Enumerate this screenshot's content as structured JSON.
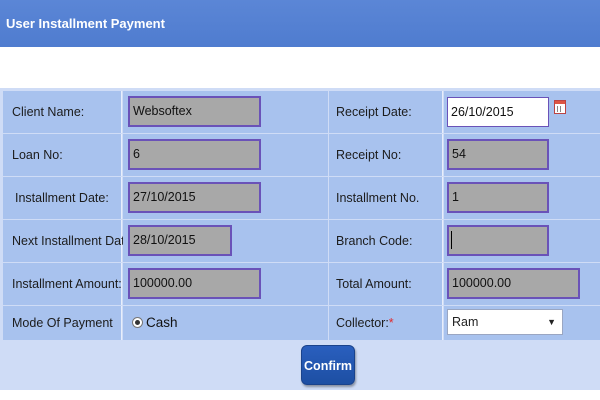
{
  "header": {
    "title": "User Installment Payment"
  },
  "form": {
    "client_name": {
      "label": "Client Name:",
      "value": "Websoftex"
    },
    "loan_no": {
      "label": "Loan No:",
      "value": "6"
    },
    "installment_date": {
      "label": "Installment Date:",
      "value": "27/10/2015"
    },
    "next_installment_date": {
      "label": "Next Installment Date:",
      "value": "28/10/2015"
    },
    "installment_amount": {
      "label": "Installment Amount:",
      "value": "100000.00"
    },
    "mode_of_payment": {
      "label": "Mode Of Payment",
      "option": "Cash",
      "selected": true
    },
    "receipt_date": {
      "label": "Receipt Date:",
      "value": "26/10/2015",
      "icon": "calendar-icon"
    },
    "receipt_no": {
      "label": "Receipt No:",
      "value": "54"
    },
    "installment_no": {
      "label": "Installment No.",
      "value": "1"
    },
    "branch_code": {
      "label": "Branch Code:",
      "value": ""
    },
    "total_amount": {
      "label": "Total  Amount:",
      "value": "100000.00"
    },
    "collector": {
      "label": "Collector:",
      "required_mark": "*",
      "value": "Ram"
    }
  },
  "actions": {
    "confirm_label": "Confirm"
  },
  "colors": {
    "header": "#5b86d6",
    "label_cell": "#a8c2ee",
    "panel": "#cfdcf6",
    "field_border": "#6a52b8",
    "button": "#2a5fbe",
    "required": "#e0282b"
  }
}
